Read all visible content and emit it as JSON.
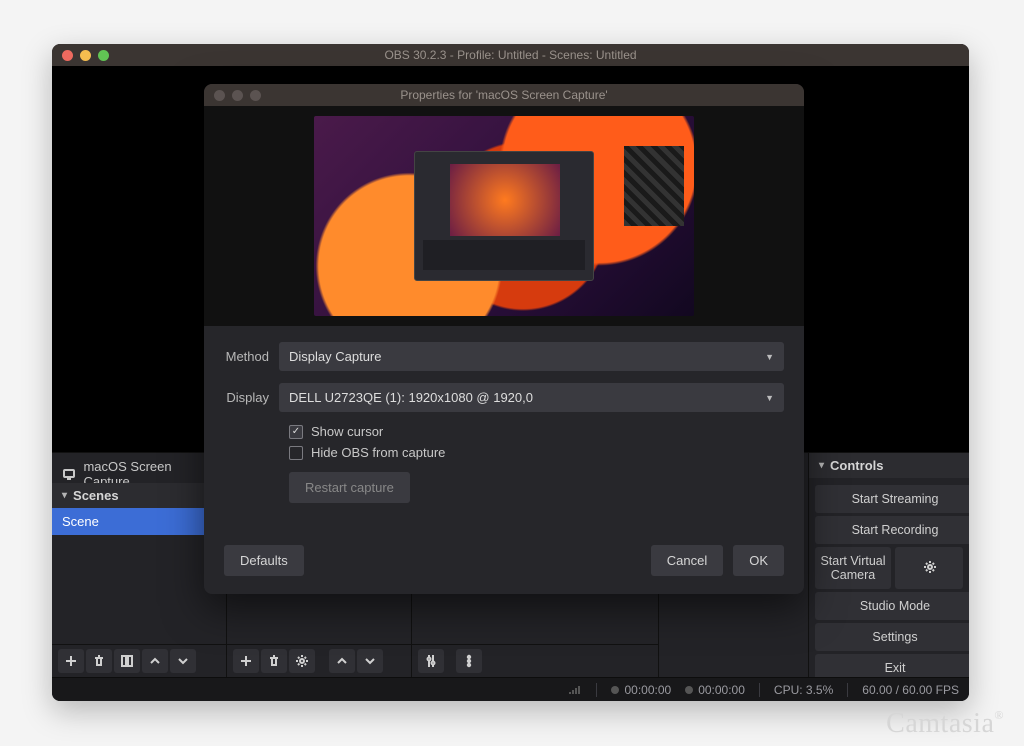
{
  "main_window": {
    "title": "OBS 30.2.3 - Profile: Untitled - Scenes: Untitled"
  },
  "sources_panel": {
    "item": "macOS Screen Capture"
  },
  "scenes_panel": {
    "header": "Scenes",
    "item": "Scene"
  },
  "controls_panel": {
    "header": "Controls",
    "buttons": {
      "stream": "Start Streaming",
      "record": "Start Recording",
      "vcam": "Start Virtual Camera",
      "studio": "Studio Mode",
      "settings": "Settings",
      "exit": "Exit"
    }
  },
  "statusbar": {
    "time1": "00:00:00",
    "time2": "00:00:00",
    "cpu": "CPU: 3.5%",
    "fps": "60.00 / 60.00 FPS"
  },
  "dialog": {
    "title": "Properties for 'macOS Screen Capture'",
    "labels": {
      "method": "Method",
      "display": "Display"
    },
    "method_value": "Display Capture",
    "display_value": "DELL U2723QE (1): 1920x1080 @ 1920,0",
    "checks": {
      "cursor": "Show cursor",
      "hide": "Hide OBS from capture"
    },
    "restart": "Restart capture",
    "buttons": {
      "defaults": "Defaults",
      "cancel": "Cancel",
      "ok": "OK"
    }
  },
  "watermark": "Camtasia"
}
